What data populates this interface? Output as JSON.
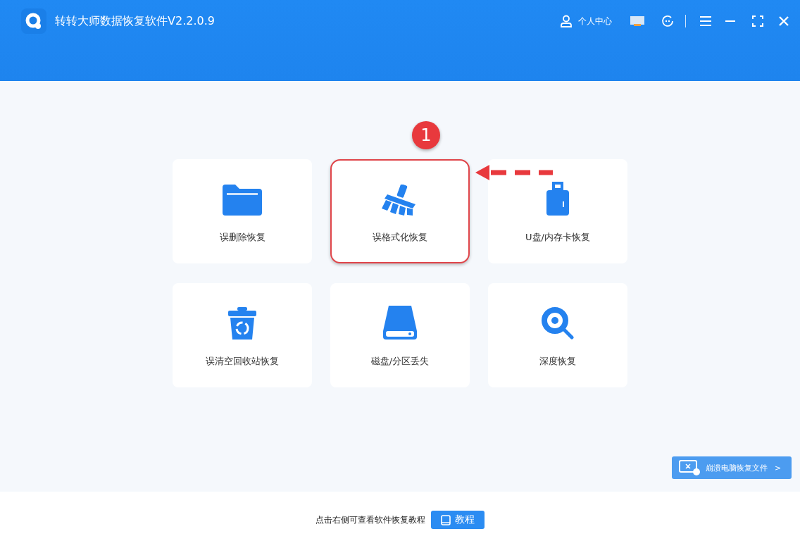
{
  "window": {
    "title": "转转大师数据恢复软件V2.2.0.9",
    "user_center": "个人中心"
  },
  "cards": [
    {
      "label": "误删除恢复",
      "kind": "folder",
      "highlighted": false
    },
    {
      "label": "误格式化恢复",
      "kind": "broom",
      "highlighted": true
    },
    {
      "label": "U盘/内存卡恢复",
      "kind": "usb",
      "highlighted": false
    },
    {
      "label": "误清空回收站恢复",
      "kind": "trash",
      "highlighted": false
    },
    {
      "label": "磁盘/分区丢失",
      "kind": "disk",
      "highlighted": false
    },
    {
      "label": "深度恢复",
      "kind": "search",
      "highlighted": false
    }
  ],
  "annotation": {
    "step": "1"
  },
  "side_button": {
    "label": "崩溃电脑恢复文件",
    "chevron": ">"
  },
  "footer": {
    "hint": "点击右侧可查看软件恢复教程",
    "button": "教程"
  }
}
